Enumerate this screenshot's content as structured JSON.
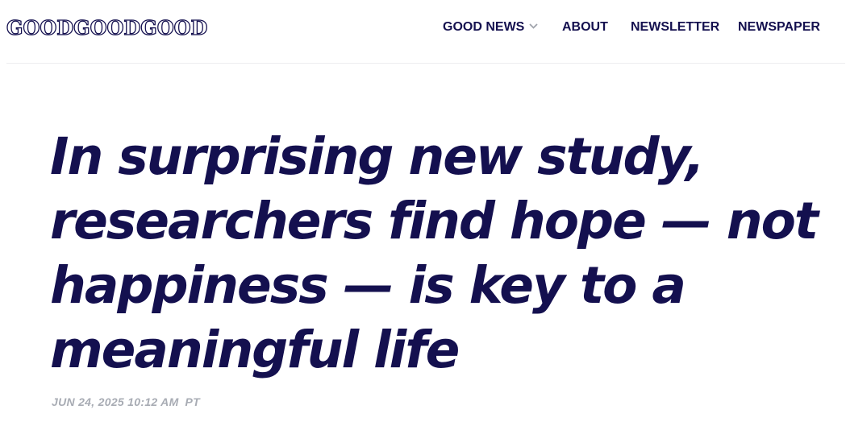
{
  "header": {
    "logo_text": "GOODGOODGOOD",
    "nav": [
      {
        "label": "GOOD NEWS",
        "has_dropdown": true
      },
      {
        "label": "ABOUT"
      },
      {
        "label": "NEWSLETTER"
      },
      {
        "label": "NEWSPAPER"
      }
    ]
  },
  "article": {
    "headline": "In surprising new study, researchers find hope — not happiness — is key to a meaningful life",
    "date": "JUN 24, 2025 10:12 AM",
    "timezone": "PT"
  },
  "colors": {
    "brand_navy": "#14104f",
    "meta_gray": "#a8acb4",
    "chevron_gray": "#a0a4ac",
    "divider": "#ececef"
  },
  "icons": {
    "dropdown": "chevron-down-icon"
  }
}
